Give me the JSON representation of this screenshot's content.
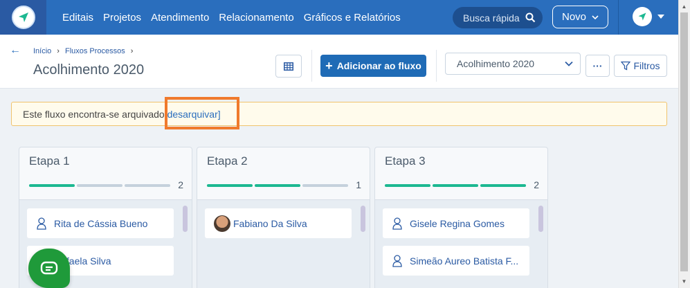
{
  "nav": {
    "links": [
      "Editais",
      "Projetos",
      "Atendimento",
      "Relacionamento",
      "Gráficos e Relatórios"
    ],
    "search_placeholder": "Busca rápida",
    "novo_label": "Novo"
  },
  "header": {
    "breadcrumb": [
      "Início",
      "Fluxos Processos"
    ],
    "title": "Acolhimento 2020",
    "add_button": "Adicionar ao fluxo",
    "select_value": "Acolhimento 2020",
    "more_label": "···",
    "filter_label": "Filtros"
  },
  "banner": {
    "text": "Este fluxo encontra-se arquivado",
    "link": "[desarquivar]"
  },
  "columns": [
    {
      "title": "Etapa 1",
      "count": "2",
      "progress_filled": 1,
      "cards": [
        "Rita de Cássia Bueno",
        "Rafaela Silva"
      ]
    },
    {
      "title": "Etapa 2",
      "count": "1",
      "progress_filled": 2,
      "cards": [
        "Fabiano Da Silva"
      ]
    },
    {
      "title": "Etapa 3",
      "count": "2",
      "progress_filled": 3,
      "cards": [
        "Gisele Regina Gomes",
        "Simeão Aureo Batista F..."
      ]
    }
  ],
  "colors": {
    "nav_bg": "#2a6ebd",
    "progress_done": "#1cb891",
    "progress_todo": "#c5d1dc",
    "highlight": "#f07a2c",
    "chat": "#1f9a3a"
  }
}
